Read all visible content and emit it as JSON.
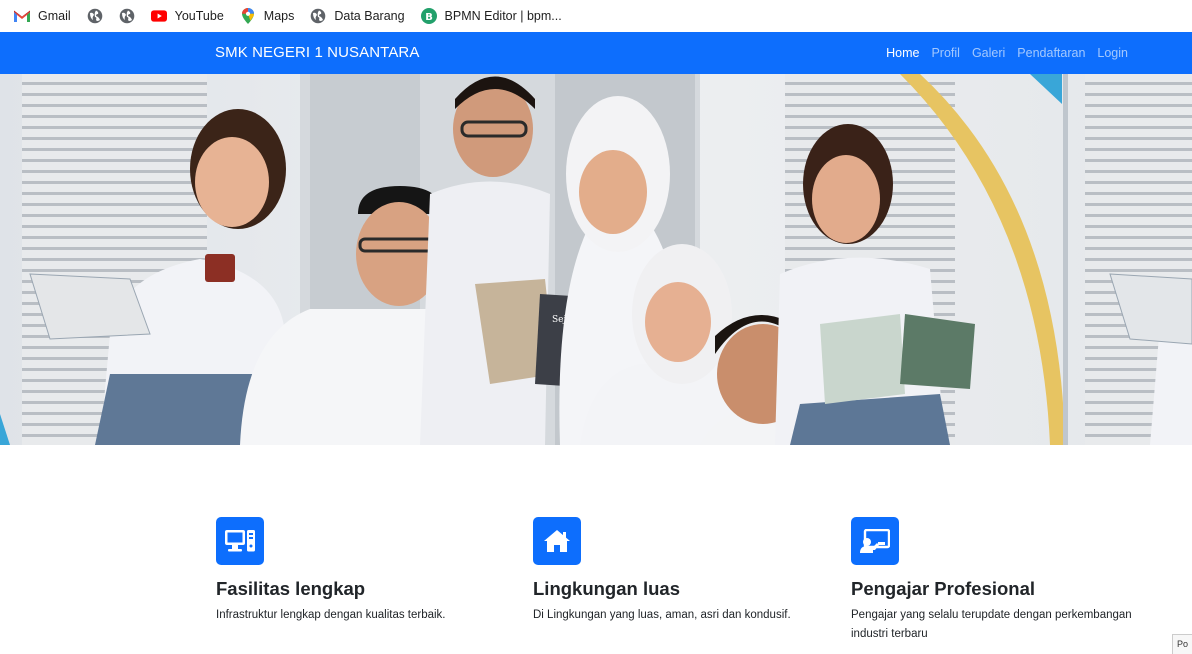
{
  "bookmarks": [
    {
      "label": "Gmail",
      "icon": "gmail-icon"
    },
    {
      "label": "",
      "icon": "globe-icon"
    },
    {
      "label": "",
      "icon": "globe-icon"
    },
    {
      "label": "YouTube",
      "icon": "youtube-icon"
    },
    {
      "label": "Maps",
      "icon": "maps-icon"
    },
    {
      "label": "Data Barang",
      "icon": "globe-icon"
    },
    {
      "label": "BPMN Editor | bpm...",
      "icon": "bpmn-icon"
    }
  ],
  "navbar": {
    "brand": "SMK NEGERI 1 NUSANTARA",
    "items": [
      {
        "label": "Home",
        "active": true
      },
      {
        "label": "Profil",
        "active": false
      },
      {
        "label": "Galeri",
        "active": false
      },
      {
        "label": "Pendaftaran",
        "active": false
      },
      {
        "label": "Login",
        "active": false
      }
    ]
  },
  "hero": {
    "image": "students-group-photo"
  },
  "features": [
    {
      "icon": "computer-icon",
      "title": "Fasilitas lengkap",
      "text": "Infrastruktur lengkap dengan kualitas terbaik."
    },
    {
      "icon": "house-icon",
      "title": "Lingkungan luas",
      "text": "Di Lingkungan yang luas, aman, asri dan kondusif."
    },
    {
      "icon": "teacher-board-icon",
      "title": "Pengajar Profesional",
      "text": "Pengajar yang selalu terupdate dengan perkembangan industri terbaru"
    }
  ],
  "corner_text": "Po",
  "colors": {
    "primary": "#0d6efd",
    "text": "#212529"
  }
}
